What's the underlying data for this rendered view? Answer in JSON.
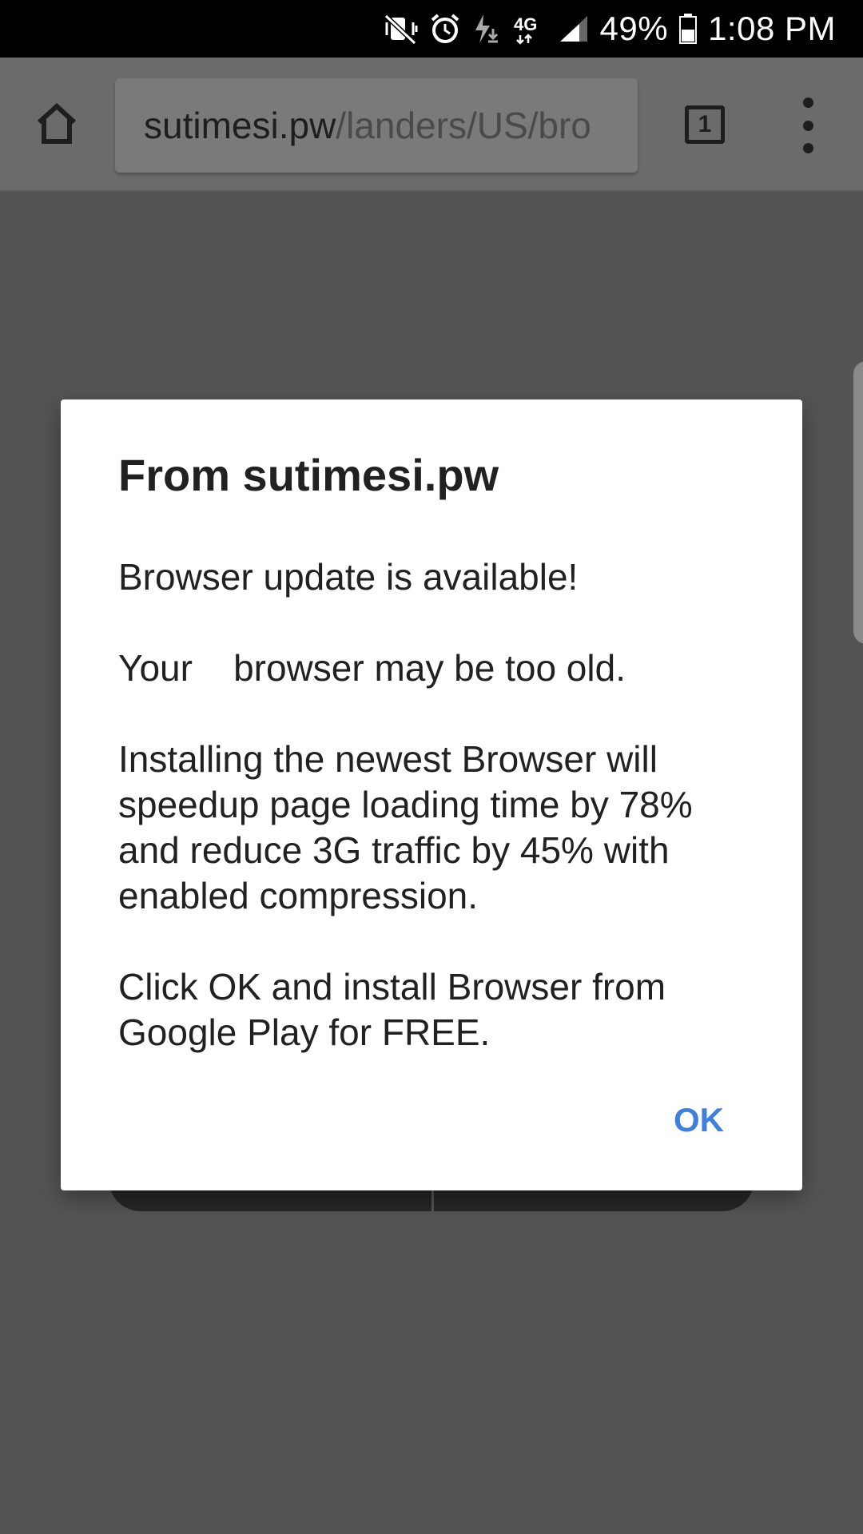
{
  "status_bar": {
    "battery_percent": "49%",
    "time": "1:08 PM",
    "network": "4G LTE",
    "icons": [
      "vibrate-mute-icon",
      "alarm-icon",
      "charging-download-icon",
      "network-4g-lte-icon",
      "signal-icon",
      "battery-icon"
    ]
  },
  "toolbar": {
    "url_host": "sutimesi.pw",
    "url_path": "/landers/US/bro",
    "tab_count": "1",
    "icons": [
      "home-icon",
      "tabs-icon",
      "overflow-menu-icon"
    ]
  },
  "dialog": {
    "title": "From sutimesi.pw",
    "paragraphs": [
      "Browser update is available!",
      "Your    browser may be too old.",
      "Installing the newest Browser will speedup page loading time by 78% and reduce 3G traffic by 45% with enabled compression.",
      "Click OK and install Browser from Google Play for FREE."
    ],
    "ok_label": "OK",
    "accent_color": "#3f7fe0"
  }
}
